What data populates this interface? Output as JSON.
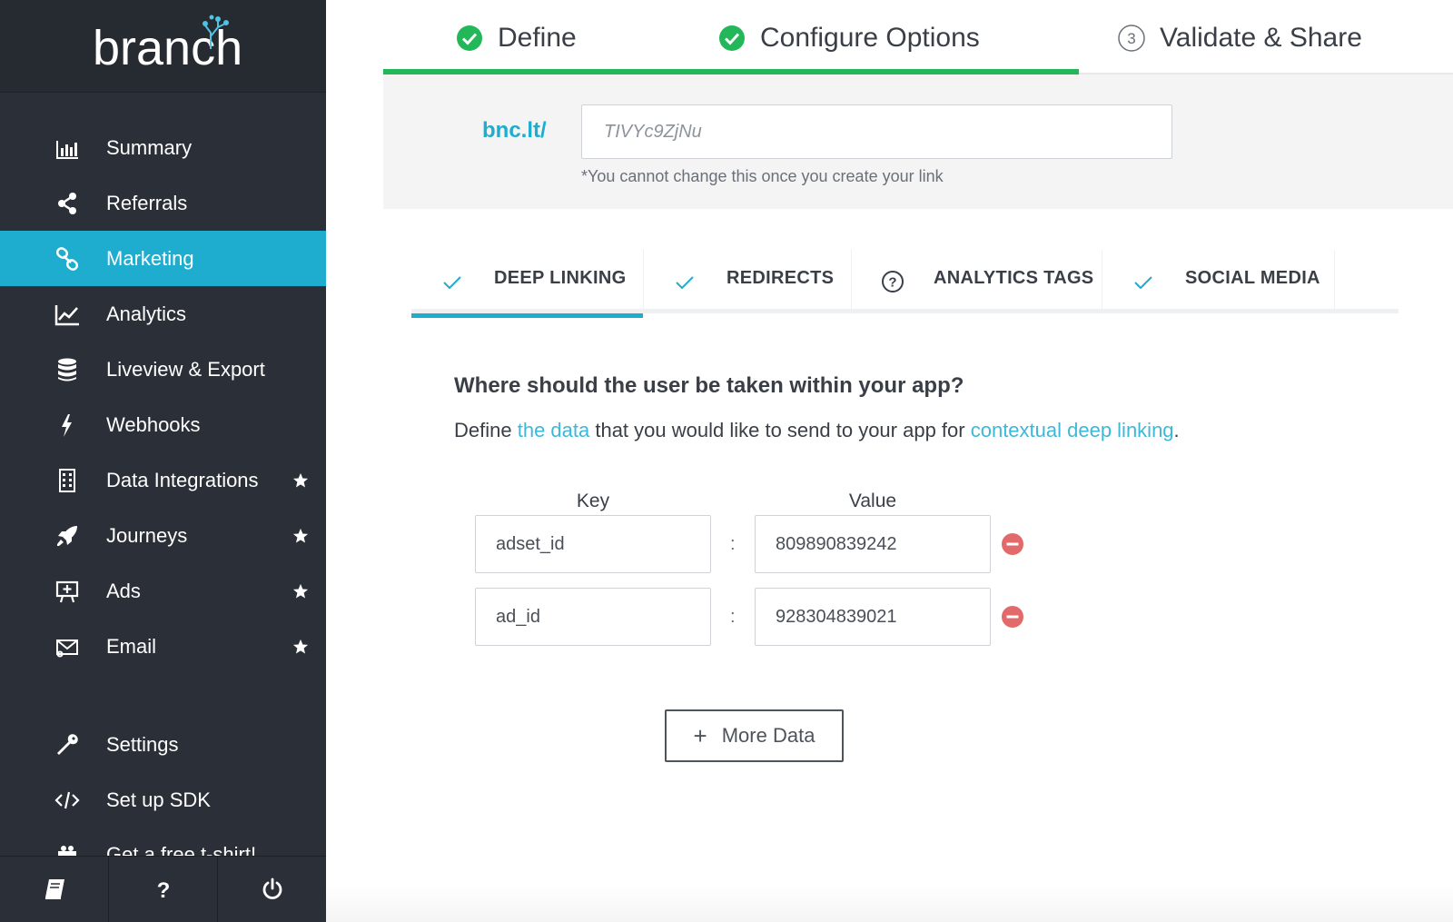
{
  "brand": {
    "name": "branch"
  },
  "sidebar": {
    "items": [
      {
        "label": "Summary",
        "icon": "bar-chart-icon",
        "starred": false,
        "active": false
      },
      {
        "label": "Referrals",
        "icon": "share-icon",
        "starred": false,
        "active": false
      },
      {
        "label": "Marketing",
        "icon": "link-icon",
        "starred": false,
        "active": true
      },
      {
        "label": "Analytics",
        "icon": "line-chart-icon",
        "starred": false,
        "active": false
      },
      {
        "label": "Liveview & Export",
        "icon": "database-icon",
        "starred": false,
        "active": false
      },
      {
        "label": "Webhooks",
        "icon": "bolt-icon",
        "starred": false,
        "active": false
      },
      {
        "label": "Data Integrations",
        "icon": "building-icon",
        "starred": true,
        "active": false
      },
      {
        "label": "Journeys",
        "icon": "rocket-icon",
        "starred": true,
        "active": false
      },
      {
        "label": "Ads",
        "icon": "billboard-icon",
        "starred": true,
        "active": false
      },
      {
        "label": "Email",
        "icon": "envelope-icon",
        "starred": true,
        "active": false
      },
      {
        "label": "Settings",
        "icon": "wrench-icon",
        "starred": false,
        "active": false
      },
      {
        "label": "Set up SDK",
        "icon": "code-icon",
        "starred": false,
        "active": false
      },
      {
        "label": "Get a free t-shirt!",
        "icon": "gift-icon",
        "starred": false,
        "active": false
      }
    ],
    "bottom": [
      {
        "icon": "book-icon"
      },
      {
        "icon": "help-icon",
        "label": "?"
      },
      {
        "icon": "power-icon"
      }
    ]
  },
  "stepper": {
    "steps": [
      {
        "label": "Define",
        "status": "done"
      },
      {
        "label": "Configure Options",
        "status": "done"
      },
      {
        "label": "Validate & Share",
        "status": "pending",
        "number": "3"
      }
    ],
    "progress_percent": 65
  },
  "link": {
    "domain": "bnc.lt/",
    "alias_placeholder": "TIVYc9ZjNu",
    "note": "*You cannot change this once you create your link"
  },
  "tabs": [
    {
      "label": "DEEP LINKING",
      "icon": "check-icon",
      "active": true
    },
    {
      "label": "REDIRECTS",
      "icon": "check-icon",
      "active": false
    },
    {
      "label": "ANALYTICS TAGS",
      "icon": "question-circle-icon",
      "active": false
    },
    {
      "label": "SOCIAL MEDIA",
      "icon": "check-icon",
      "active": false
    }
  ],
  "deep_linking": {
    "question": "Where should the user be taken within your app?",
    "desc_prefix": "Define ",
    "desc_link1": "the data",
    "desc_middle": " that you would like to send to your app for ",
    "desc_link2": "contextual deep linking",
    "desc_suffix": ".",
    "key_header": "Key",
    "value_header": "Value",
    "separator": ":",
    "rows": [
      {
        "key": "adset_id",
        "value": "809890839242"
      },
      {
        "key": "ad_id",
        "value": "928304839021"
      }
    ],
    "more_plus": "+",
    "more_label": "More Data"
  },
  "colors": {
    "accent": "#1eaccf",
    "success": "#22b85a",
    "danger": "#e36a6a",
    "sidebar_bg": "#2b3038"
  }
}
